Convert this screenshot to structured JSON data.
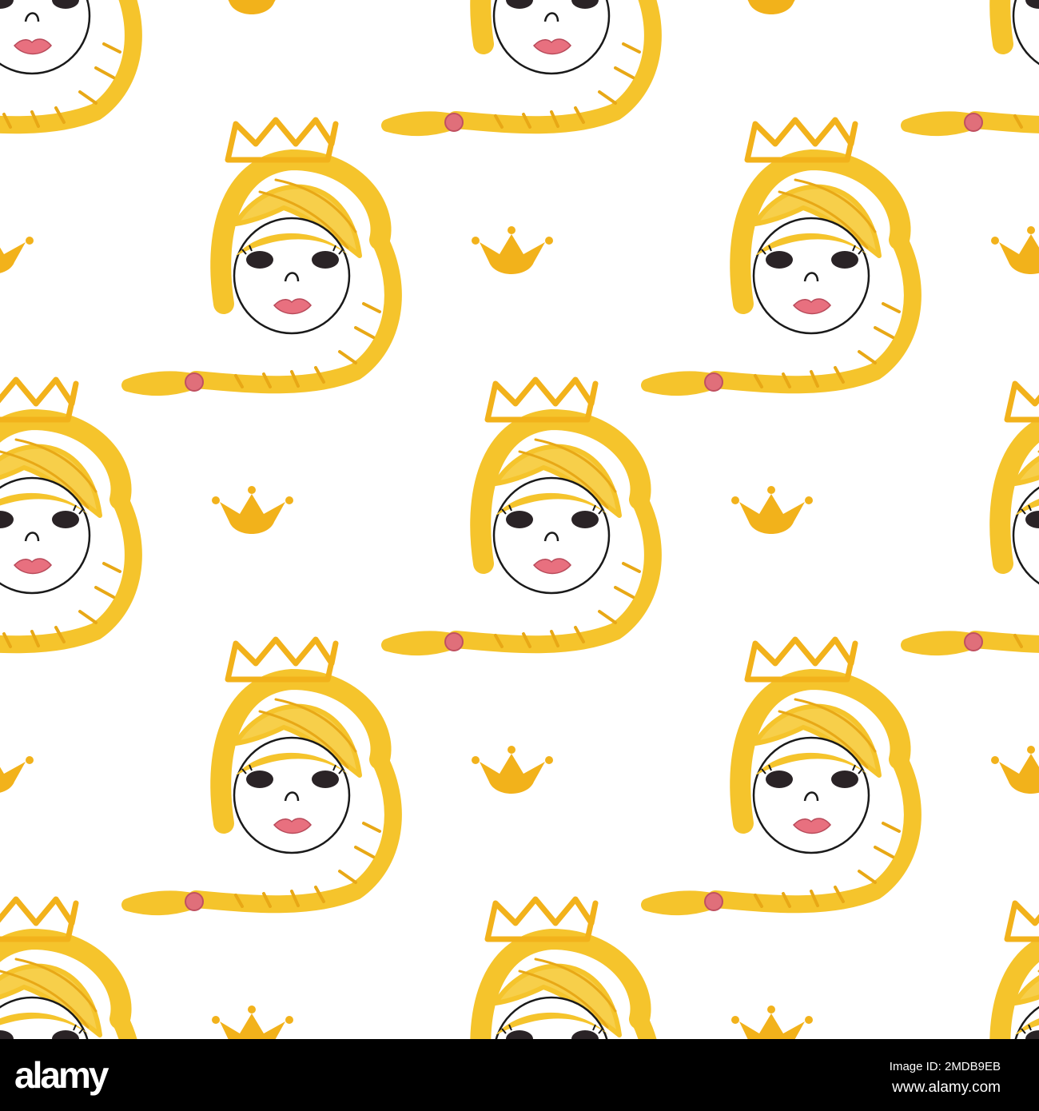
{
  "pattern": {
    "colors": {
      "hair": "#f5c42c",
      "crown": "#f2b21b",
      "lips": "#e8707f",
      "bead": "#e06f7a",
      "outline": "#1a1a1a",
      "background": "#ffffff"
    }
  },
  "footer": {
    "logo": "alamy",
    "image_id": "Image ID: 2MDB9EB",
    "website": "www.alamy.com"
  }
}
